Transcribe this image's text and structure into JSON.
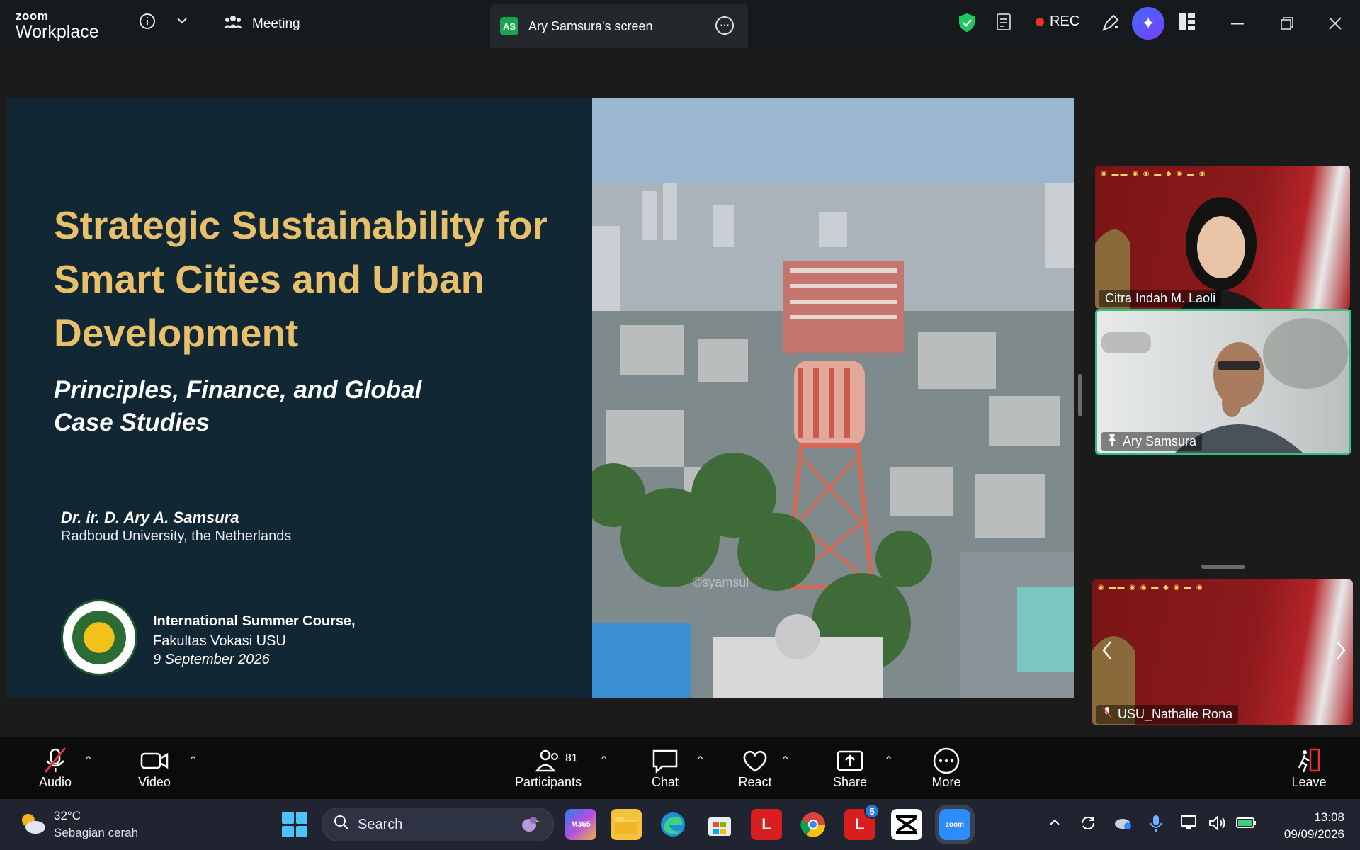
{
  "titlebar": {
    "brand_top": "zoom",
    "brand_bottom": "Workplace",
    "meeting_label": "Meeting",
    "screen_tab": {
      "badge": "AS",
      "label": "Ary Samsura's screen"
    },
    "rec_label": "REC"
  },
  "slide": {
    "title": "Strategic Sustainability for Smart Cities and Urban Development",
    "subtitle": "Principles, Finance, and Global Case Studies",
    "presenter": "Dr. ir. D. Ary A. Samsura",
    "affiliation": "Radboud University, the Netherlands",
    "course": "International Summer Course,",
    "faculty": "Fakultas Vokasi USU",
    "date": "9 September 2026",
    "photo_watermark": "©syamsul"
  },
  "participants": [
    {
      "name": "Citra Indah M. Laoli",
      "muted": false
    },
    {
      "name": "Ary Samsura",
      "muted": false,
      "active_speaker": true
    },
    {
      "name": "USU_Nathalie Rona",
      "muted": true
    }
  ],
  "toolbar": {
    "audio": "Audio",
    "video": "Video",
    "participants": "Participants",
    "participants_count": "81",
    "chat": "Chat",
    "react": "React",
    "share": "Share",
    "more": "More",
    "leave": "Leave"
  },
  "taskbar": {
    "temperature": "32°C",
    "weather": "Sebagian cerah",
    "search_placeholder": "Search",
    "notification_badge": "5",
    "time": "13:08",
    "date": "09/09/2026"
  },
  "colors": {
    "slide_bg": "#112734",
    "title_gold": "#e8bf6a",
    "active_border": "#2ec27e",
    "rec_red": "#e5342e"
  }
}
